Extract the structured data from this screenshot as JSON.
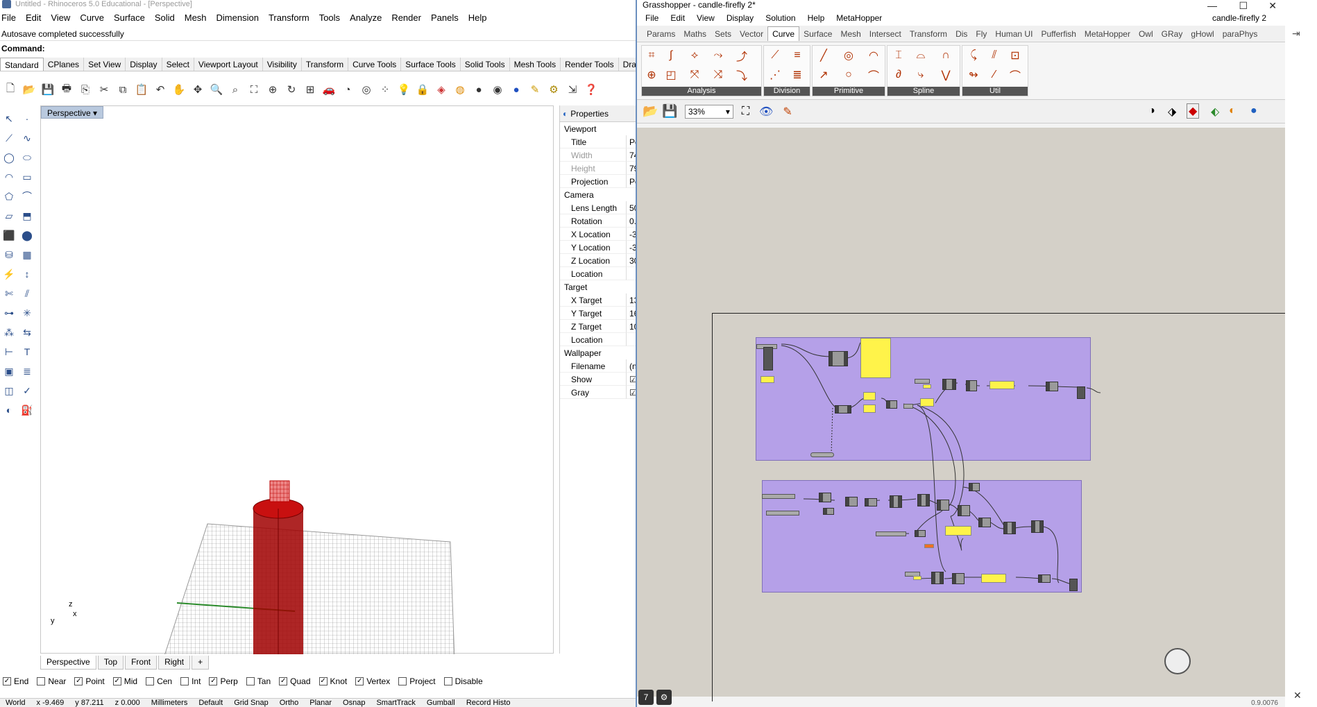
{
  "rhino": {
    "title": "Untitled - Rhinoceros 5.0 Educational - [Perspective]",
    "menus": [
      "File",
      "Edit",
      "View",
      "Curve",
      "Surface",
      "Solid",
      "Mesh",
      "Dimension",
      "Transform",
      "Tools",
      "Analyze",
      "Render",
      "Panels",
      "Help"
    ],
    "history": "Autosave completed successfully",
    "command_label": "Command:",
    "toolbar_tabs": [
      "Standard",
      "CPlanes",
      "Set View",
      "Display",
      "Select",
      "Viewport Layout",
      "Visibility",
      "Transform",
      "Curve Tools",
      "Surface Tools",
      "Solid Tools",
      "Mesh Tools",
      "Render Tools",
      "Dra"
    ],
    "viewport_label": "Perspective",
    "axis": {
      "x": "x",
      "y": "y",
      "z": "z"
    },
    "view_tabs": [
      "Perspective",
      "Top",
      "Front",
      "Right"
    ],
    "osnaps": [
      {
        "label": "End",
        "checked": true
      },
      {
        "label": "Near",
        "checked": false
      },
      {
        "label": "Point",
        "checked": true
      },
      {
        "label": "Mid",
        "checked": true
      },
      {
        "label": "Cen",
        "checked": false
      },
      {
        "label": "Int",
        "checked": false
      },
      {
        "label": "Perp",
        "checked": true
      },
      {
        "label": "Tan",
        "checked": false
      },
      {
        "label": "Quad",
        "checked": true
      },
      {
        "label": "Knot",
        "checked": true
      },
      {
        "label": "Vertex",
        "checked": true
      },
      {
        "label": "Project",
        "checked": false
      },
      {
        "label": "Disable",
        "checked": false
      }
    ],
    "status": [
      "World",
      "x -9.469",
      "y 87.211",
      "z 0.000",
      "Millimeters",
      "Default",
      "Grid Snap",
      "Ortho",
      "Planar",
      "Osnap",
      "SmartTrack",
      "Gumball",
      "Record Histo"
    ],
    "properties": {
      "tab": "Properties",
      "sections": [
        {
          "title": "Viewport",
          "rows": [
            {
              "k": "Title",
              "v": "Pe",
              "dim": false
            },
            {
              "k": "Width",
              "v": "74",
              "dim": true
            },
            {
              "k": "Height",
              "v": "79",
              "dim": true
            },
            {
              "k": "Projection",
              "v": "Pe",
              "dim": false
            }
          ]
        },
        {
          "title": "Camera",
          "rows": [
            {
              "k": "Lens Length",
              "v": "50",
              "dim": false
            },
            {
              "k": "Rotation",
              "v": "0.",
              "dim": false
            },
            {
              "k": "X Location",
              "v": "-3",
              "dim": false
            },
            {
              "k": "Y Location",
              "v": "-3",
              "dim": false
            },
            {
              "k": "Z Location",
              "v": "30",
              "dim": false
            },
            {
              "k": "Location",
              "v": "",
              "dim": false
            }
          ]
        },
        {
          "title": "Target",
          "rows": [
            {
              "k": "X Target",
              "v": "13",
              "dim": false
            },
            {
              "k": "Y Target",
              "v": "16",
              "dim": false
            },
            {
              "k": "Z Target",
              "v": "10",
              "dim": false
            },
            {
              "k": "Location",
              "v": "",
              "dim": false
            }
          ]
        },
        {
          "title": "Wallpaper",
          "rows": [
            {
              "k": "Filename",
              "v": "(no",
              "dim": false
            },
            {
              "k": "Show",
              "v": "☑",
              "dim": false
            },
            {
              "k": "Gray",
              "v": "☑",
              "dim": false
            }
          ]
        }
      ]
    }
  },
  "grasshopper": {
    "title": "Grasshopper - candle-firefly 2*",
    "doc_name": "candle-firefly 2",
    "menus": [
      "File",
      "Edit",
      "View",
      "Display",
      "Solution",
      "Help",
      "MetaHopper"
    ],
    "tabs": [
      "Params",
      "Maths",
      "Sets",
      "Vector",
      "Curve",
      "Surface",
      "Mesh",
      "Intersect",
      "Transform",
      "Dis",
      "Fly",
      "Human UI",
      "Pufferfish",
      "MetaHopper",
      "Owl",
      "GRay",
      "gHowl",
      "paraPhys"
    ],
    "active_tab": "Curve",
    "groups": [
      "Analysis",
      "Division",
      "Primitive",
      "Spline",
      "Util"
    ],
    "zoom": "33%",
    "version": "0.9.0076"
  },
  "colors": {
    "group": "#b5a0e8",
    "panel": "#fff34a",
    "candle": "#a00000",
    "canvas": "#d4d0c8"
  }
}
